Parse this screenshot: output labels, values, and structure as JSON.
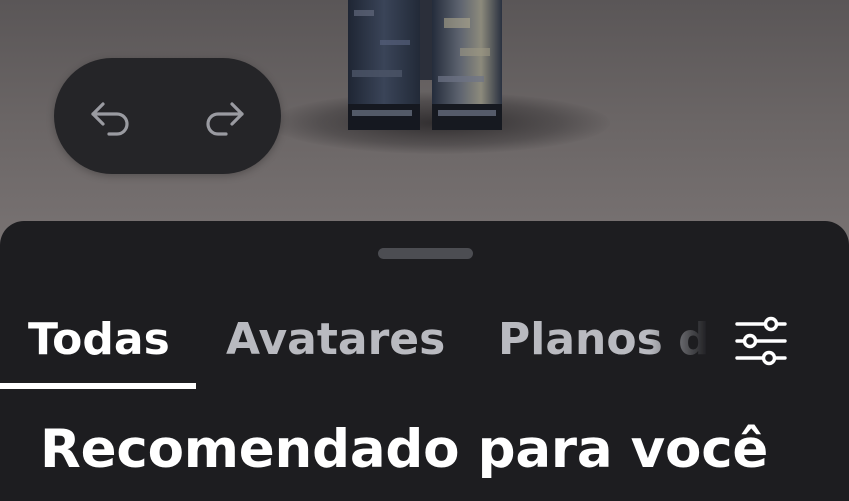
{
  "preview": {
    "undo_icon": "undo-arrow-icon",
    "redo_icon": "redo-arrow-icon"
  },
  "tabs": [
    {
      "label": "Todas",
      "active": true
    },
    {
      "label": "Avatares",
      "active": false
    },
    {
      "label": "Planos de fundo",
      "active": false
    }
  ],
  "filter_icon": "sliders-icon",
  "section": {
    "title": "Recomendado para você"
  },
  "colors": {
    "sheet_background": "#1d1d20",
    "pill_background": "#252528",
    "active_tab": "#ffffff",
    "inactive_tab": "#b9bac0",
    "handle": "#4c4d52"
  }
}
